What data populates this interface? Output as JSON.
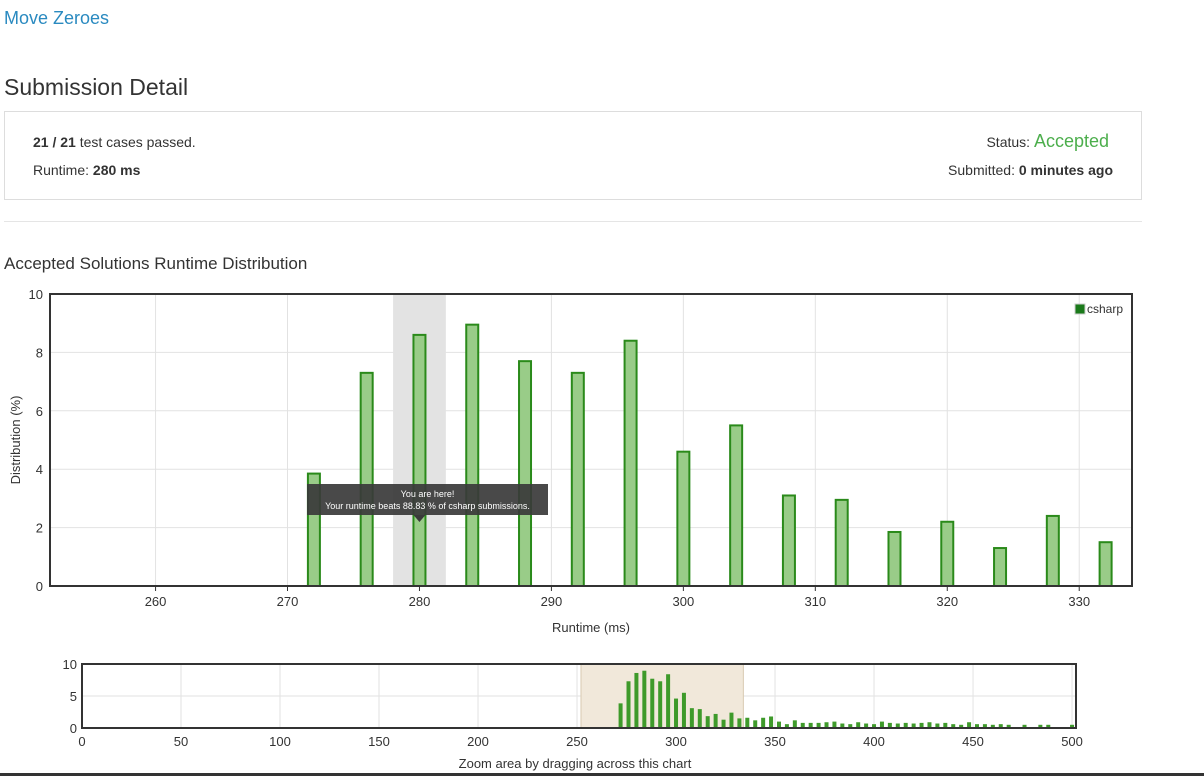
{
  "problem_title": "Move Zeroes",
  "page_heading": "Submission Detail",
  "summary": {
    "passed": "21",
    "separator": " / ",
    "total": "21",
    "passed_suffix": " test cases passed.",
    "runtime_label": "Runtime: ",
    "runtime_value": "280 ms",
    "status_label": "Status: ",
    "status_value": "Accepted",
    "submitted_label": "Submitted: ",
    "submitted_value": "0 minutes ago"
  },
  "colors": {
    "accent_link": "#2a8ac0",
    "accepted": "#4cae4c",
    "bar_fill": "#99cc88",
    "bar_stroke": "#2a8a1a",
    "legend_swatch": "#1a7a1a",
    "highlight_band": "#e3e3e3",
    "nav_selection": "#f1e8da"
  },
  "chart_heading": "Accepted Solutions Runtime Distribution",
  "tooltip": {
    "line1": "You are here!",
    "line2": "Your runtime beats 88.83 % of csharp submissions."
  },
  "navigator_caption": "Zoom area by dragging across this chart",
  "chart_data": [
    {
      "type": "bar",
      "name": "main",
      "xlabel": "Runtime (ms)",
      "ylabel": "Distribution (%)",
      "xlim": [
        252,
        334
      ],
      "ylim": [
        0,
        10
      ],
      "x_ticks": [
        260,
        270,
        280,
        290,
        300,
        310,
        320,
        330
      ],
      "y_ticks": [
        0,
        2,
        4,
        6,
        8,
        10
      ],
      "grid": true,
      "legend": "top-right",
      "series": [
        {
          "name": "csharp",
          "x": [
            272,
            276,
            280,
            284,
            288,
            292,
            296,
            300,
            304,
            308,
            312,
            316,
            320,
            324,
            328,
            332
          ],
          "values": [
            3.85,
            7.3,
            8.6,
            8.95,
            7.7,
            7.3,
            8.4,
            4.6,
            5.5,
            3.1,
            2.95,
            1.85,
            2.2,
            1.3,
            2.4,
            1.5
          ]
        }
      ],
      "highlight_range": [
        278,
        282
      ]
    },
    {
      "type": "bar",
      "name": "navigator",
      "xlim": [
        0,
        502
      ],
      "ylim": [
        0,
        10
      ],
      "x_ticks": [
        0,
        50,
        100,
        150,
        200,
        250,
        300,
        350,
        400,
        450,
        500
      ],
      "y_ticks": [
        0,
        5,
        10
      ],
      "grid": true,
      "selected_range": [
        252,
        334
      ],
      "series": [
        {
          "name": "csharp",
          "x": [
            272,
            276,
            280,
            284,
            288,
            292,
            296,
            300,
            304,
            308,
            312,
            316,
            320,
            324,
            328,
            332,
            336,
            340,
            344,
            348,
            352,
            356,
            360,
            364,
            368,
            372,
            376,
            380,
            384,
            388,
            392,
            396,
            400,
            404,
            408,
            412,
            416,
            420,
            424,
            428,
            432,
            436,
            440,
            444,
            448,
            452,
            456,
            460,
            464,
            468,
            476,
            484,
            488,
            500
          ],
          "values": [
            3.85,
            7.3,
            8.6,
            8.95,
            7.7,
            7.3,
            8.4,
            4.6,
            5.5,
            3.1,
            2.95,
            1.85,
            2.2,
            1.3,
            2.4,
            1.5,
            1.6,
            1.2,
            1.6,
            1.8,
            1.0,
            0.6,
            1.2,
            0.8,
            0.8,
            0.8,
            0.9,
            1.0,
            0.7,
            0.6,
            0.9,
            0.7,
            0.6,
            1.0,
            0.8,
            0.7,
            0.8,
            0.7,
            0.8,
            0.9,
            0.7,
            0.8,
            0.6,
            0.5,
            0.9,
            0.6,
            0.6,
            0.5,
            0.6,
            0.5,
            0.5,
            0.5,
            0.5,
            0.5
          ]
        }
      ]
    }
  ]
}
